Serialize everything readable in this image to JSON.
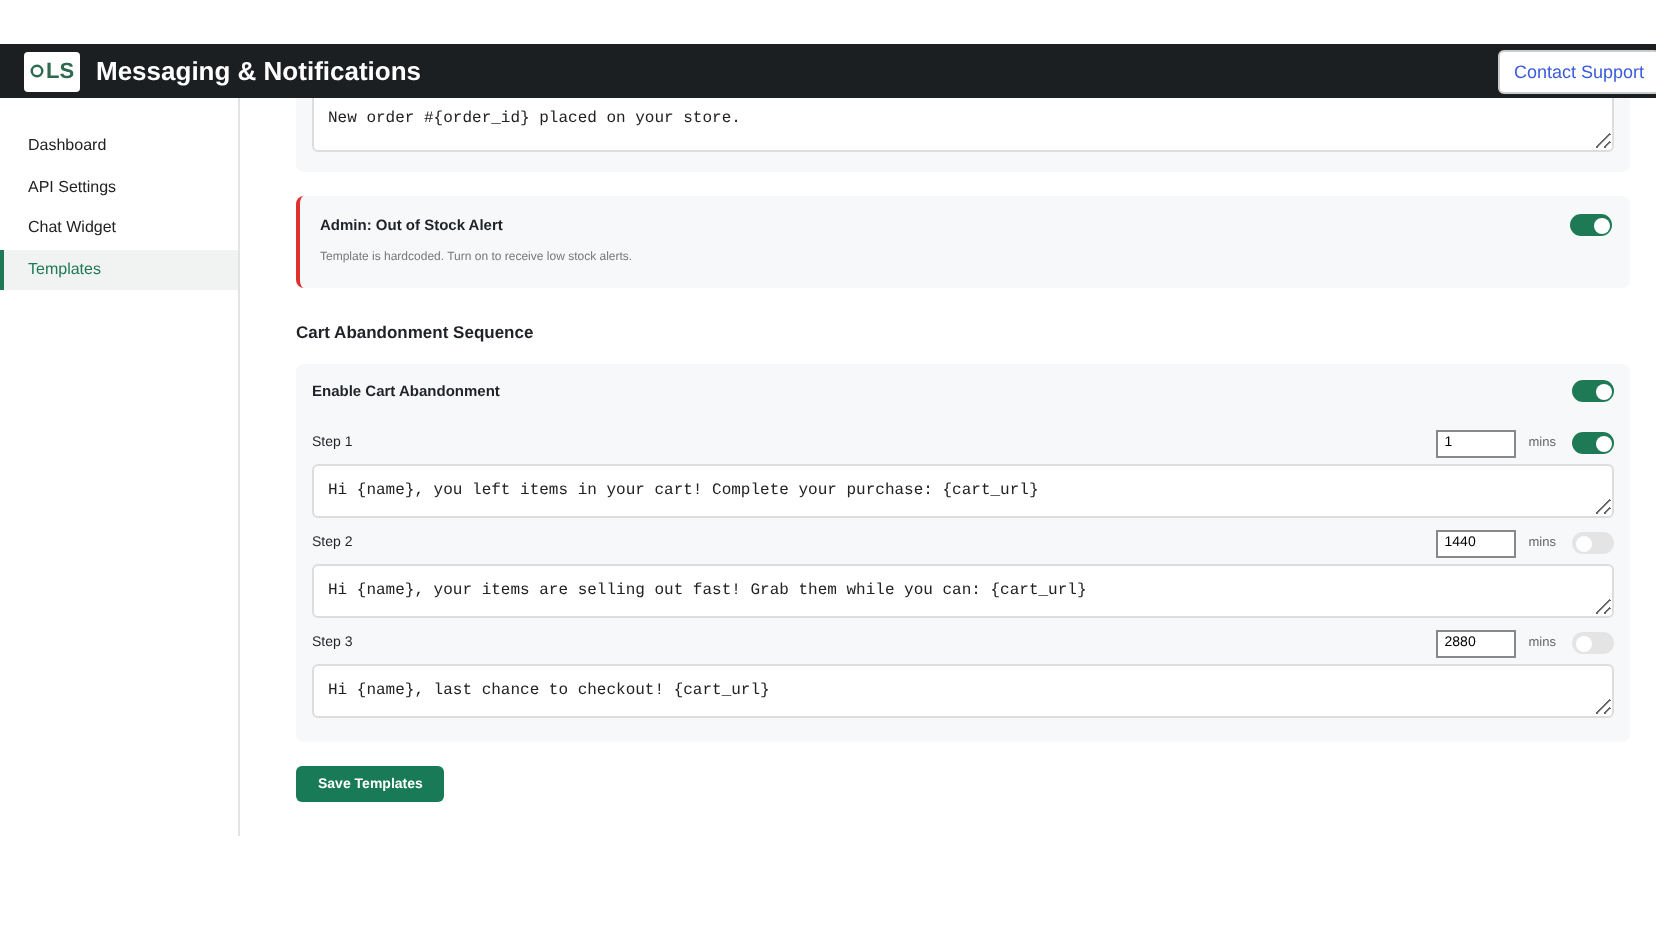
{
  "header": {
    "logo": "LS",
    "title": "Messaging & Notifications",
    "contact_button": "Contact Support"
  },
  "sidebar": {
    "items": [
      {
        "label": "Dashboard",
        "selected": false
      },
      {
        "label": "API Settings",
        "selected": false
      },
      {
        "label": "Chat Widget",
        "selected": false
      },
      {
        "label": "Templates",
        "selected": true
      }
    ]
  },
  "order_template": {
    "value": "New order #{order_id} placed on your store."
  },
  "stock_alert": {
    "title": "Admin: Out of Stock Alert",
    "note": "Template is hardcoded. Turn on to receive low stock alerts.",
    "on": true
  },
  "cart_abandonment": {
    "heading": "Cart Abandonment Sequence",
    "enable_label": "Enable Cart Abandonment",
    "enabled": true,
    "steps": [
      {
        "label": "Step 1",
        "delay": "1",
        "unit": "mins",
        "on": true,
        "message": "Hi {name}, you left items in your cart! Complete your purchase: {cart_url}"
      },
      {
        "label": "Step 2",
        "delay": "1440",
        "unit": "mins",
        "on": false,
        "message": "Hi {name}, your items are selling out fast! Grab them while you can: {cart_url}"
      },
      {
        "label": "Step 3",
        "delay": "2880",
        "unit": "mins",
        "on": false,
        "message": "Hi {name}, last chance to checkout! {cart_url}"
      }
    ]
  },
  "save_button": "Save Templates"
}
